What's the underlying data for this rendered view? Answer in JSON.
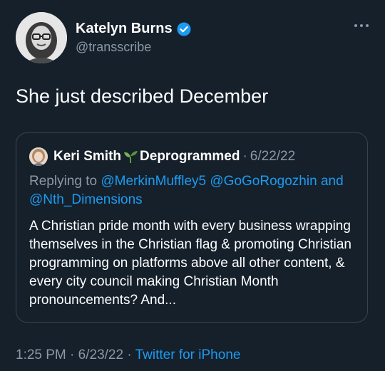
{
  "tweet": {
    "author_name": "Katelyn Burns",
    "author_handle": "@transscribe",
    "text": "She just described December",
    "time": "1:25 PM",
    "separator": "·",
    "date": "6/23/22",
    "source": "Twitter for iPhone"
  },
  "quote": {
    "author_name": "Keri Smith",
    "author_name_suffix": "Deprogrammed",
    "separator": "·",
    "date": "6/22/22",
    "replying_prefix": "Replying to",
    "mention_1": "@MerkinMuffley5",
    "mention_2": "@GoGoRogozhin",
    "and_word": "and",
    "mention_3": "@Nth_Dimensions",
    "text": "A Christian pride month with every business wrapping themselves in the Christian flag & promoting Christian programming on platforms above all other content, & every city council making Christian Month pronouncements? And..."
  },
  "icons": {
    "more": "more-horizontal-icon",
    "verified": "verified-badge-icon",
    "sprout": "seedling-emoji-icon"
  },
  "colors": {
    "background": "#15202b",
    "text_primary": "#ffffff",
    "text_secondary": "#8b98a5",
    "accent": "#1d9bf0",
    "border": "#38444d"
  }
}
